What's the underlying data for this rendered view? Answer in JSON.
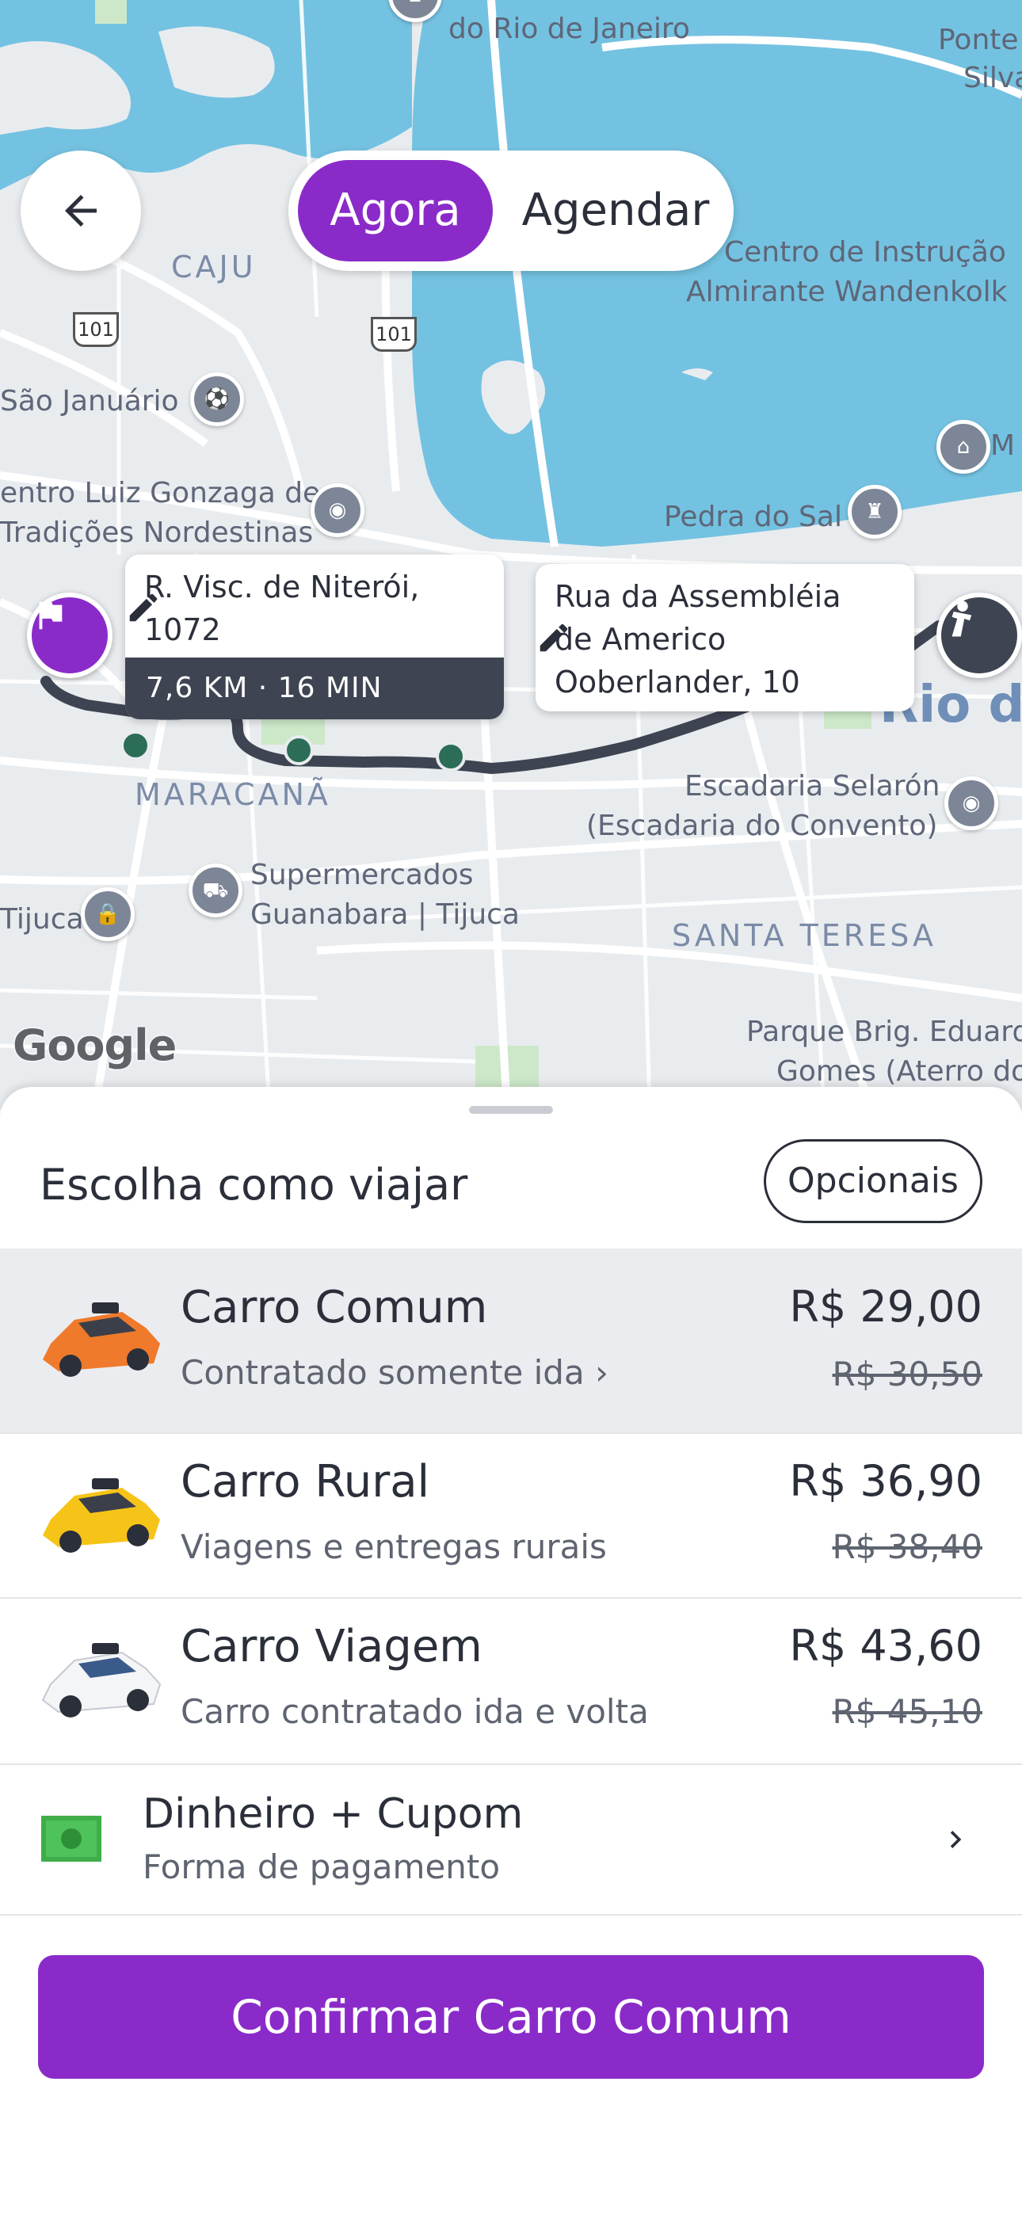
{
  "map": {
    "labels": {
      "rio_janeiro": "do Rio de Janeiro",
      "ponte": "Ponte",
      "silva": "Silva",
      "caju": "CAJU",
      "centro_instrucao_1": "Centro de Instrução",
      "centro_instrucao_2": "Almirante Wandenkolk",
      "sao_januario": "São Januário",
      "gonzaga_1": "entro Luiz Gonzaga de",
      "gonzaga_2": "Tradições Nordestinas",
      "pedra_do_sal": "Pedra do Sal",
      "rio_big": "Rio de",
      "maracana": "MARACANÃ",
      "selaron_1": "Escadaria Selarón",
      "selaron_2": "(Escadaria do Convento)",
      "supermercados_1": "Supermercados",
      "supermercados_2": "Guanabara | Tijuca",
      "tijuca": "Tijuca",
      "santa_teresa": "SANTA TERESA",
      "parque_1": "Parque Brig. Eduard",
      "parque_2": "Gomes (Aterro do",
      "m": "M"
    },
    "road_shields": [
      "101",
      "101"
    ],
    "google_logo": "Google"
  },
  "top_controls": {
    "toggle": {
      "active": "Agora",
      "inactive": "Agendar"
    }
  },
  "route": {
    "origin": "R. Visc. de Niterói, 1072",
    "eta": "7,6 KM · 16 MIN",
    "destination": "Rua da Assembléia de Americo Ooberlander, 10"
  },
  "sheet": {
    "title": "Escolha como viajar",
    "options_button": "Opcionais",
    "rides": [
      {
        "name": "Carro Comum",
        "desc": "Contratado somente ida",
        "price": "R$ 29,00",
        "old_price": "R$ 30,50",
        "selected": true
      },
      {
        "name": "Carro Rural",
        "desc": "Viagens e entregas rurais",
        "price": "R$ 36,90",
        "old_price": "R$ 38,40",
        "selected": false
      },
      {
        "name": "Carro Viagem",
        "desc": "Carro contratado ida e volta",
        "price": "R$ 43,60",
        "old_price": "R$ 45,10",
        "selected": false
      }
    ],
    "payment": {
      "label": "Dinheiro + Cupom",
      "sub": "Forma de pagamento"
    },
    "confirm_button": "Confirmar Carro Comum"
  },
  "colors": {
    "accent": "#8a2bc9",
    "water": "#74c2e1",
    "route_line": "#3f4452"
  }
}
